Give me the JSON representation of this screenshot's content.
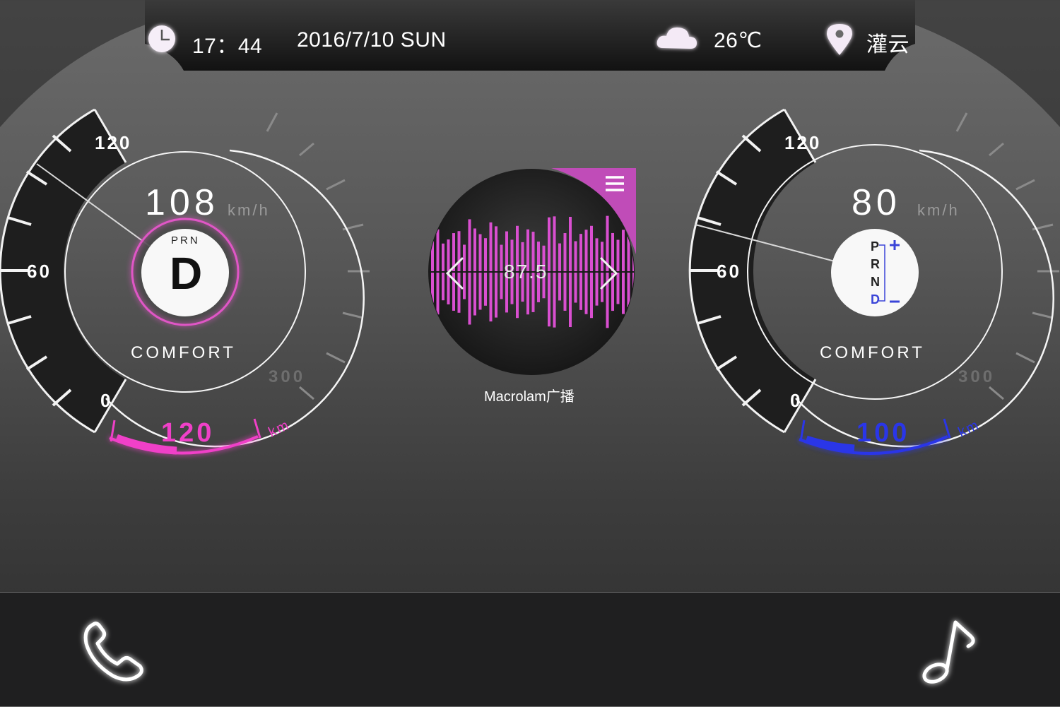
{
  "status_bar": {
    "time": "17：44",
    "date": "2016/7/10 SUN",
    "temperature": "26℃",
    "location": "灌云",
    "icons": [
      "clock-icon",
      "cloud-icon",
      "location-pin-icon"
    ]
  },
  "left_gauge": {
    "speed": "108",
    "speed_unit": "km/h",
    "tick_labels": [
      "120",
      "60",
      "0"
    ],
    "outer_scale_label": "300",
    "gear_header": "PRN",
    "gear": "D",
    "mode": "COMFORT",
    "range_value": "120",
    "range_unit": "km",
    "accent_color": "#f040c8"
  },
  "right_gauge": {
    "speed": "80",
    "speed_unit": "km/h",
    "tick_labels": [
      "120",
      "60",
      "0"
    ],
    "outer_scale_label": "300",
    "gears": [
      "P",
      "R",
      "N",
      "D"
    ],
    "active_gear": "D",
    "shift_plus": "+",
    "shift_minus": "–",
    "mode": "COMFORT",
    "range_value": "100",
    "range_unit": "km",
    "accent_color": "#2a36e8"
  },
  "radio": {
    "frequency": "87.5",
    "station": "Macrolam广播",
    "accent_color": "#d94fd0",
    "icons": [
      "menu-icon",
      "prev-arrow-icon",
      "next-arrow-icon"
    ]
  },
  "bottom_bar": {
    "icons": [
      "phone-icon",
      "music-note-icon"
    ]
  }
}
